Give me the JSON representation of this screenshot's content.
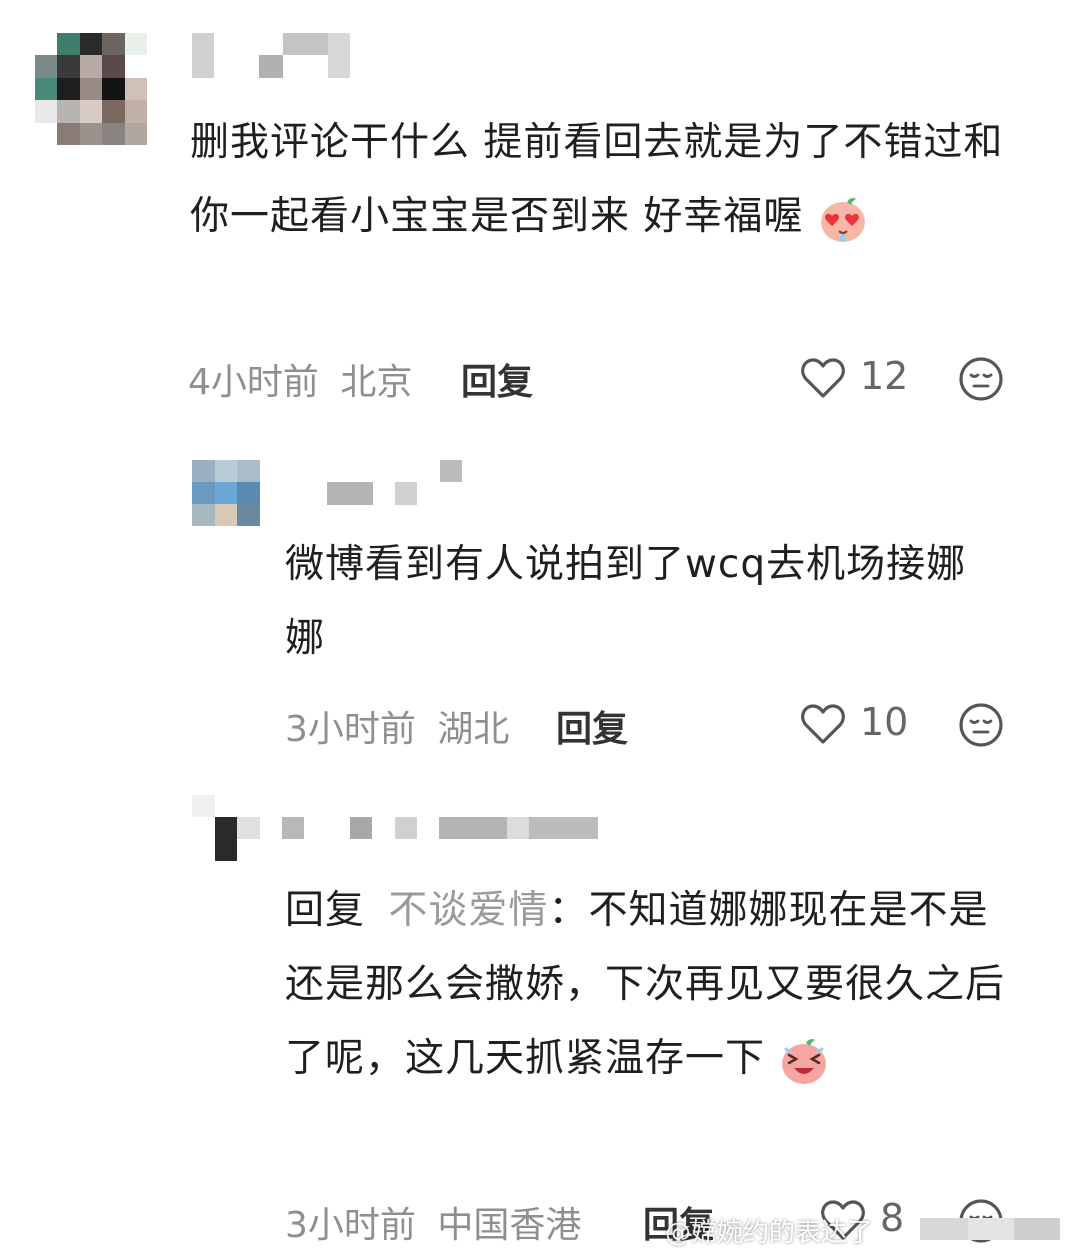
{
  "comments": [
    {
      "text": "删我评论干什么 提前看回去就是为了不错过和你一起看小宝宝是否到来 好幸福喔",
      "emoji": "heart-eyes-emoji",
      "time": "4小时前",
      "location": "北京",
      "reply_label": "回复",
      "likes": "12"
    },
    {
      "text": "微博看到有人说拍到了wcq去机场接娜娜",
      "time": "3小时前",
      "location": "湖北",
      "reply_label": "回复",
      "likes": "10"
    },
    {
      "reply_prefix": "回复",
      "reply_to": "不谈爱情",
      "text": "：不知道娜娜现在是不是还是那么会撒娇，下次再见又要很久之后了呢，这几天抓紧温存一下",
      "emoji": "laughing-emoji",
      "time": "3小时前",
      "location": "中国香港",
      "reply_label": "回复",
      "likes": "8"
    }
  ],
  "watermark": "@嫦婉约的表达了",
  "colors": {
    "meta": "#8f8f8f",
    "reply_to": "#9a9a9a",
    "text": "#1f1f1f"
  }
}
